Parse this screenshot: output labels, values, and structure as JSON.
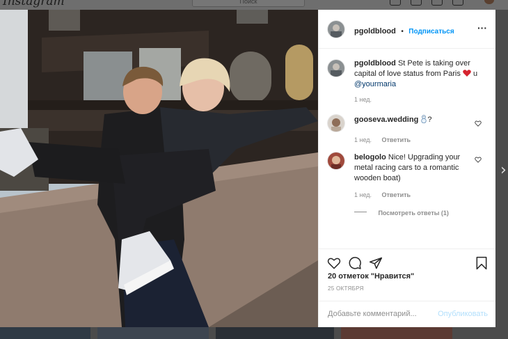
{
  "background": {
    "logo": "Instagram",
    "search_placeholder": "Поиск"
  },
  "post": {
    "author": "pgoldblood",
    "follow_label": "Подписаться",
    "more_icon": "more-icon",
    "caption": {
      "username": "pgoldblood",
      "text": "St Pete is taking over capital of love status from Paris",
      "emoji": "red-heart",
      "mention_prefix": "u",
      "mention": "@yourmaria",
      "time": "1 нед."
    },
    "comments": [
      {
        "username": "gooseva.wedding",
        "text": "?",
        "emoji": "snowman-icon",
        "time": "1 нед.",
        "reply_label": "Ответить"
      },
      {
        "username": "belogolo",
        "text": "Nice! Upgrading your metal racing cars to a romantic wooden boat)",
        "time": "1 нед.",
        "reply_label": "Ответить",
        "view_replies": "Посмотреть ответы (1)"
      }
    ],
    "likes": "20 отметок \"Нравится\"",
    "date": "25 ОКТЯБРЯ",
    "comment_placeholder": "Добавьте комментарий...",
    "publish_label": "Опубликовать"
  },
  "colors": {
    "accent": "#0095f6",
    "heart": "#ed4956",
    "publish_disabled": "#b2dffc"
  }
}
